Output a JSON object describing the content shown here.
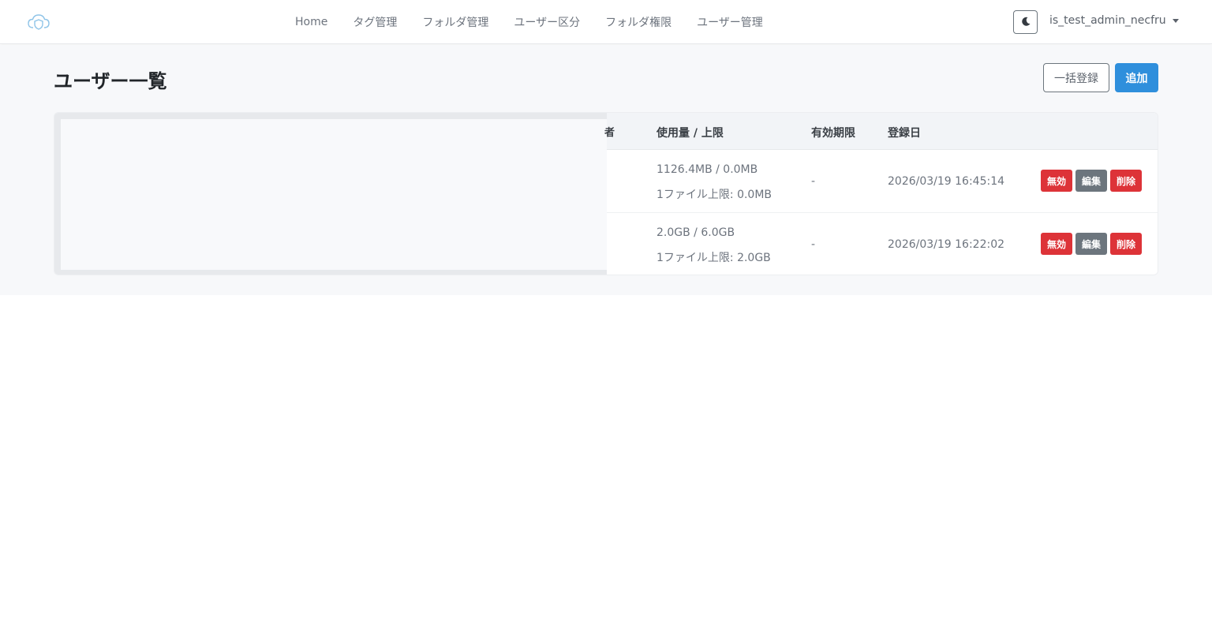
{
  "nav": {
    "links": [
      "Home",
      "タグ管理",
      "フォルダ管理",
      "ユーザー区分",
      "フォルダ権限",
      "ユーザー管理"
    ],
    "username": "is_test_admin_necfru",
    "icons": {
      "logo": "cloud-shield-icon",
      "theme": "moon-icon"
    }
  },
  "page": {
    "title": "ユーザー一覧",
    "bulk_label": "一括登録",
    "add_label": "追加"
  },
  "table": {
    "edge_glyph": "者",
    "headers": [
      "使用量 / 上限",
      "有効期限",
      "登録日"
    ],
    "rows": [
      {
        "usage": "1126.4MB / 0.0MB",
        "file_limit": "1ファイル上限: 0.0MB",
        "expiry": "-",
        "registered": "2026/03/19 16:45:14"
      },
      {
        "usage": "2.0GB / 6.0GB",
        "file_limit": "1ファイル上限: 2.0GB",
        "expiry": "-",
        "registered": "2026/03/19 16:22:02"
      }
    ],
    "actions": {
      "disable": "無効",
      "edit": "編集",
      "delete": "削除"
    }
  },
  "colors": {
    "primary": "#2f8fdc",
    "danger": "#dd3338",
    "secondary": "#6c757d"
  }
}
